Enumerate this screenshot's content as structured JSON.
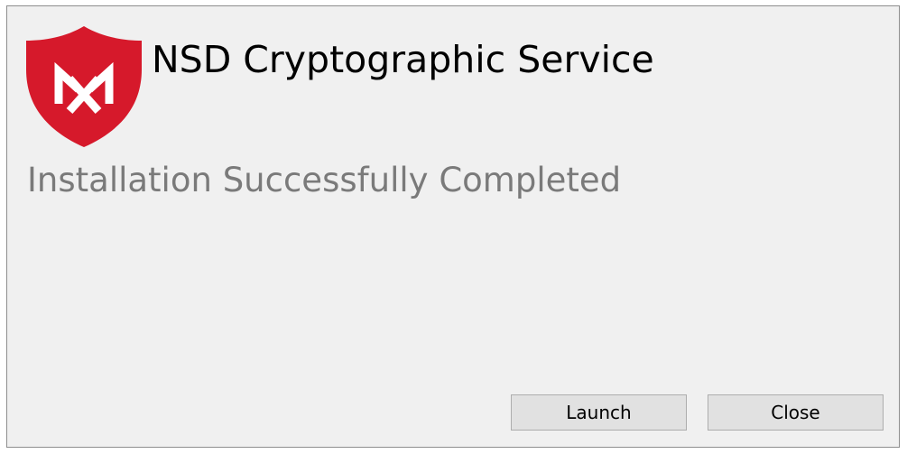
{
  "window": {
    "app_title": "NSD Cryptographic Service",
    "logo_icon": "shield-logo-icon",
    "status_message": "Installation Successfully Completed"
  },
  "buttons": {
    "launch_label": "Launch",
    "close_label": "Close"
  },
  "colors": {
    "brand_red": "#d6192b",
    "status_text": "#7a7a7a",
    "dialog_background": "#f0f0f0",
    "button_background": "#e1e1e1"
  }
}
